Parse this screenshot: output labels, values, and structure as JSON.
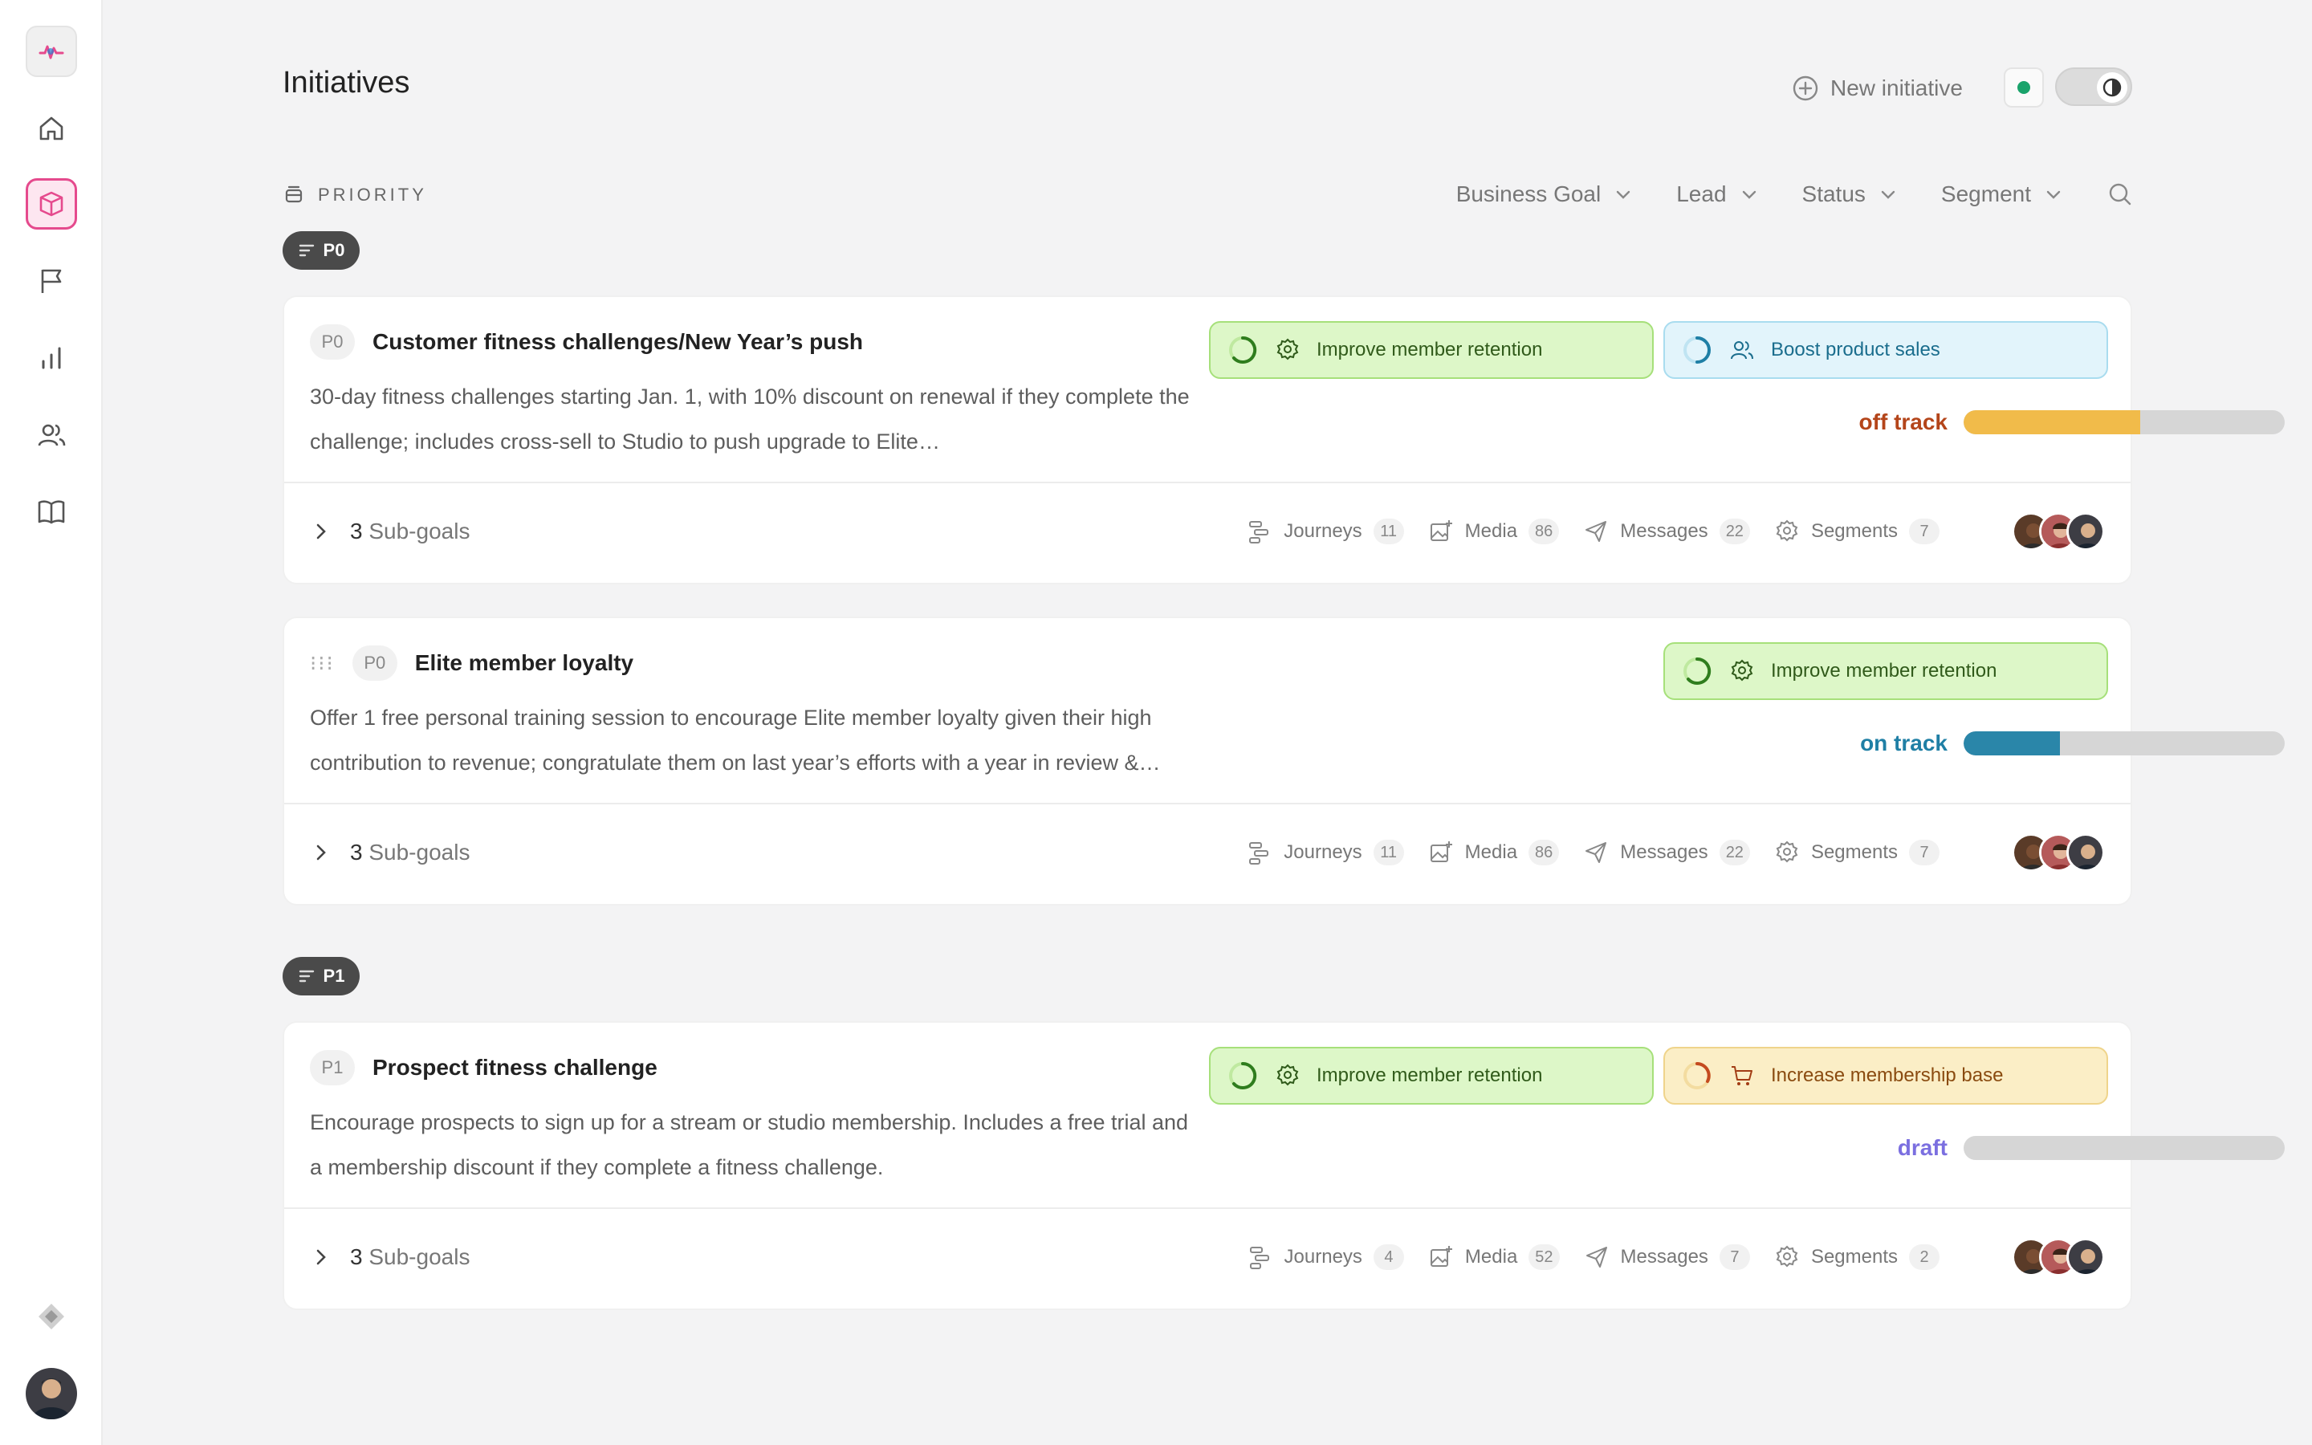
{
  "header": {
    "title": "Initiatives",
    "new_initiative": "New initiative"
  },
  "filters": {
    "group_label": "PRIORITY",
    "items": [
      "Business Goal",
      "Lead",
      "Status",
      "Segment"
    ]
  },
  "groups": [
    {
      "priority": "P0",
      "initiatives": [
        {
          "tag": "P0",
          "title": "Customer fitness challenges/New Year’s push",
          "description": "30-day fitness challenges starting Jan. 1, with 10% discount on renewal if they complete the challenge; includes cross-sell to Studio to push upgrade to Elite…",
          "goals": [
            "Improve member retention",
            "Boost product sales"
          ],
          "status": "off track",
          "progress": 0.55,
          "subgoals_count": "3",
          "subgoals_label": "Sub-goals",
          "stats": {
            "journeys": "Journeys",
            "journeys_n": "11",
            "media": "Media",
            "media_n": "86",
            "messages": "Messages",
            "messages_n": "22",
            "segments": "Segments",
            "segments_n": "7"
          }
        },
        {
          "tag": "P0",
          "title": "Elite member loyalty",
          "description": "Offer 1 free personal training session to encourage Elite member loyalty given their high contribution to revenue; congratulate them on last year’s efforts with a year in review &…",
          "goals": [
            "Improve member retention"
          ],
          "status": "on track",
          "progress": 0.3,
          "subgoals_count": "3",
          "subgoals_label": "Sub-goals",
          "stats": {
            "journeys": "Journeys",
            "journeys_n": "11",
            "media": "Media",
            "media_n": "86",
            "messages": "Messages",
            "messages_n": "22",
            "segments": "Segments",
            "segments_n": "7"
          }
        }
      ]
    },
    {
      "priority": "P1",
      "initiatives": [
        {
          "tag": "P1",
          "title": "Prospect fitness challenge",
          "description": "Encourage prospects to sign up for a stream or studio membership. Includes a free trial and a membership discount if they complete a fitness challenge.",
          "goals": [
            "Improve member retention",
            "Increase membership base"
          ],
          "status": "draft",
          "progress": 0,
          "subgoals_count": "3",
          "subgoals_label": "Sub-goals",
          "stats": {
            "journeys": "Journeys",
            "journeys_n": "4",
            "media": "Media",
            "media_n": "52",
            "messages": "Messages",
            "messages_n": "7",
            "segments": "Segments",
            "segments_n": "2"
          }
        }
      ]
    }
  ],
  "colors": {
    "accent": "#e54a8d",
    "off_track": "#b4451a",
    "on_track": "#1f7fa5",
    "draft": "#7b6fe0",
    "bar_off_track": "#f1bb4a",
    "bar_on_track": "#2a86a9"
  },
  "icons": [
    "logo-icon",
    "home-icon",
    "box-icon",
    "flag-icon",
    "chart-icon",
    "users-icon",
    "book-icon",
    "diamond-icon"
  ]
}
